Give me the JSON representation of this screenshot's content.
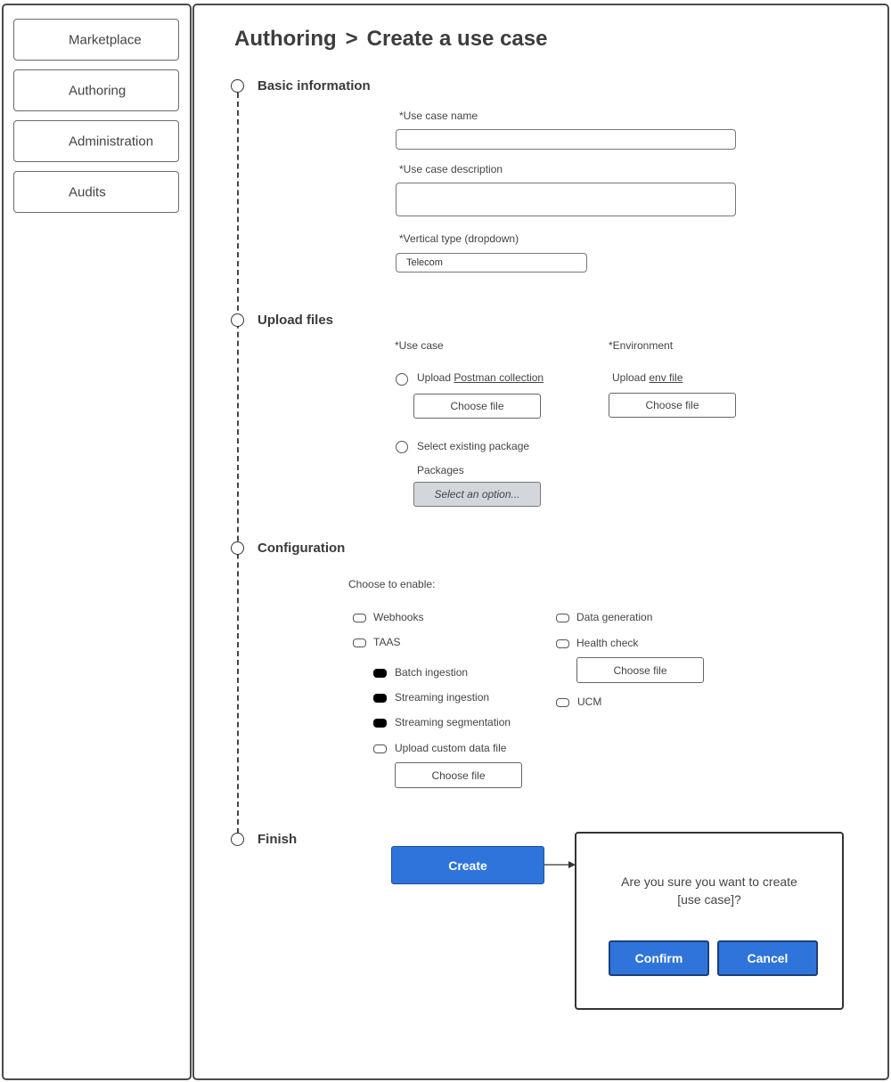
{
  "sidebar": {
    "items": [
      {
        "label": "Marketplace"
      },
      {
        "label": "Authoring"
      },
      {
        "label": "Administration"
      },
      {
        "label": "Audits"
      }
    ]
  },
  "header": {
    "breadcrumb_parent": "Authoring",
    "separator": ">",
    "page_title": "Create a use case"
  },
  "steps": {
    "basic": {
      "label": "Basic information",
      "name_label": "*Use case name",
      "name_value": "",
      "description_label": "*Use case description",
      "description_value": "",
      "vertical_label": "*Vertical type (dropdown)",
      "vertical_value": "Telecom"
    },
    "upload": {
      "label": "Upload files",
      "use_case_heading": "*Use case",
      "environment_heading": "*Environment",
      "upload_postman_prefix": "Upload ",
      "upload_postman_link": "Postman collection",
      "upload_env_prefix": "Upload ",
      "upload_env_link": "env file",
      "choose_file": "Choose file",
      "select_existing": "Select existing package",
      "packages_label": "Packages",
      "packages_placeholder": "Select an option..."
    },
    "config": {
      "label": "Configuration",
      "choose_label": "Choose to enable:",
      "webhooks": "Webhooks",
      "taas": "TAAS",
      "batch_ingestion": "Batch ingestion",
      "streaming_ingestion": "Streaming ingestion",
      "streaming_segmentation": "Streaming segmentation",
      "upload_custom": "Upload custom data file",
      "data_generation": "Data generation",
      "health_check": "Health check",
      "ucm": "UCM",
      "choose_file": "Choose file"
    },
    "finish": {
      "label": "Finish",
      "create_button": "Create"
    }
  },
  "dialog": {
    "message_line1": "Are you sure you want to create",
    "message_line2": "[use case]?",
    "confirm": "Confirm",
    "cancel": "Cancel"
  },
  "colors": {
    "primary": "#2f74db",
    "select_bg": "#d3d7dc"
  }
}
